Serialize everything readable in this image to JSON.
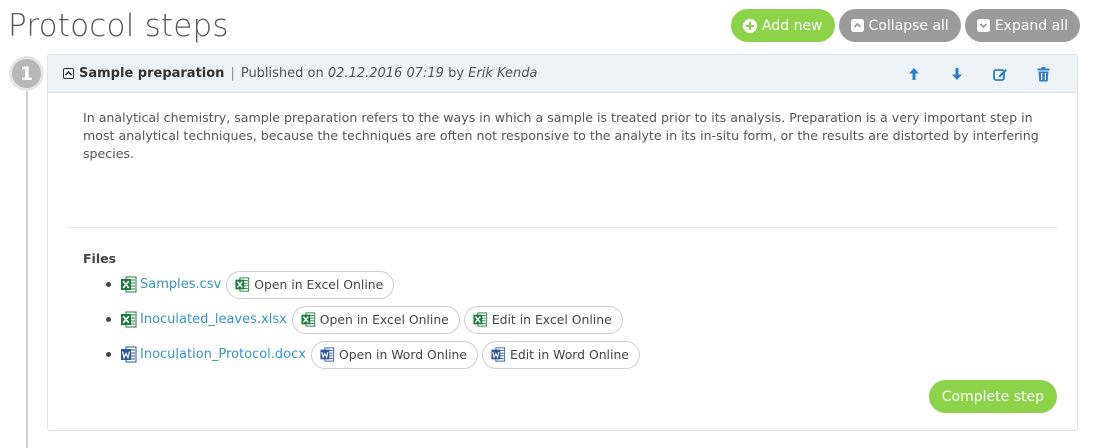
{
  "page": {
    "title": "Protocol steps"
  },
  "top_actions": {
    "add_new": "Add new",
    "collapse_all": "Collapse all",
    "expand_all": "Expand all"
  },
  "step": {
    "number": "1",
    "name": "Sample preparation",
    "published_prefix": "Published on",
    "published_date": "02.12.2016 07:19",
    "by_text": "by",
    "author": "Erik Kenda",
    "description": "In analytical chemistry, sample preparation refers to the ways in which a sample is treated prior to its analysis. Preparation is a very important step in most analytical techniques, because the techniques are often not responsive to the analyte in its in-situ form, or the results are distorted by interfering species.",
    "files_title": "Files",
    "files": [
      {
        "name": "Samples.csv",
        "type": "excel",
        "actions": [
          "Open in Excel Online"
        ]
      },
      {
        "name": "Inoculated_leaves.xlsx",
        "type": "excel",
        "actions": [
          "Open in Excel Online",
          "Edit in Excel Online"
        ]
      },
      {
        "name": "Inoculation_Protocol.docx",
        "type": "word",
        "actions": [
          "Open in Word Online",
          "Edit in Word Online"
        ]
      }
    ],
    "complete_label": "Complete step"
  },
  "colors": {
    "accent_green": "#8cd34a",
    "gray_button": "#9b9b9b",
    "link_blue": "#3a93c8",
    "icon_blue": "#2e7fc2",
    "excel_green": "#1f7a3f",
    "word_blue": "#2b5797"
  },
  "icons": {
    "add": "plus-circle-icon",
    "collapse": "collapse-square-icon",
    "expand": "expand-square-icon",
    "move_up": "arrow-up-icon",
    "move_down": "arrow-down-icon",
    "edit": "edit-icon",
    "delete": "trash-icon"
  }
}
